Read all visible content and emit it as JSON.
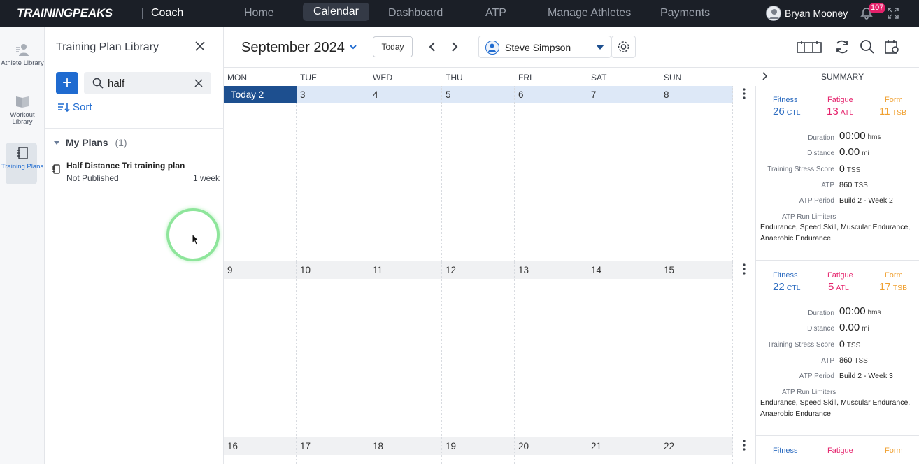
{
  "topnav": {
    "logo": "TRAININGPEAKS",
    "product": "Coach",
    "items": [
      "Home",
      "Calendar",
      "Dashboard",
      "ATP",
      "Manage Athletes",
      "Payments"
    ],
    "active_index": 1,
    "user_name": "Bryan Mooney",
    "notification_count": "107"
  },
  "rail": {
    "items": [
      {
        "label": "Athlete Library",
        "icon": "athlete-library-icon"
      },
      {
        "label": "Workout Library",
        "icon": "workout-library-icon"
      },
      {
        "label": "Training Plans",
        "icon": "training-plans-icon",
        "active": true
      }
    ]
  },
  "library": {
    "title": "Training Plan Library",
    "search_value": "half",
    "sort_label": "Sort",
    "group_label": "My Plans",
    "group_count": "(1)",
    "plans": [
      {
        "name": "Half Distance Tri training plan",
        "status": "Not Published",
        "duration": "1 week"
      }
    ]
  },
  "calendar": {
    "month_label": "September 2024",
    "today_label": "Today",
    "athlete": "Steve Simpson",
    "day_names": [
      "MON",
      "TUE",
      "WED",
      "THU",
      "FRI",
      "SAT",
      "SUN"
    ],
    "summary_label": "SUMMARY",
    "weeks": [
      {
        "days": [
          "Today 2",
          "3",
          "4",
          "5",
          "6",
          "7",
          "8"
        ],
        "current": true
      },
      {
        "days": [
          "9",
          "10",
          "11",
          "12",
          "13",
          "14",
          "15"
        ]
      },
      {
        "days": [
          "16",
          "17",
          "18",
          "19",
          "20",
          "21",
          "22"
        ]
      }
    ]
  },
  "summary": {
    "labels": {
      "fitness": "Fitness",
      "fatigue": "Fatigue",
      "form": "Form",
      "ctl": "CTL",
      "atl": "ATL",
      "tsb": "TSB",
      "duration": "Duration",
      "distance": "Distance",
      "tss_label": "Training Stress Score",
      "atp": "ATP",
      "atp_period": "ATP Period",
      "atp_limiters": "ATP Run Limiters",
      "hms": "hms",
      "mi": "mi",
      "tss": "TSS"
    },
    "weeks": [
      {
        "fitness": "26",
        "fatigue": "13",
        "form": "11",
        "duration": "00:00",
        "distance": "0.00",
        "tss": "0",
        "atp": "860",
        "period": "Build 2 - Week 2",
        "limiters": "Endurance, Speed Skill, Muscular Endurance, Anaerobic Endurance"
      },
      {
        "fitness": "22",
        "fatigue": "5",
        "form": "17",
        "duration": "00:00",
        "distance": "0.00",
        "tss": "0",
        "atp": "860",
        "period": "Build 2 - Week 3",
        "limiters": "Endurance, Speed Skill, Muscular Endurance, Anaerobic Endurance"
      },
      {
        "fitness": "",
        "fatigue": "",
        "form": ""
      }
    ]
  },
  "colors": {
    "nav_bg": "#1b1f27",
    "accent": "#1f6bd0",
    "today_bg": "#1d4f8f",
    "fitness": "#2d6cc0",
    "fatigue": "#e5216b",
    "form": "#f0a030",
    "badge": "#e5216b"
  }
}
